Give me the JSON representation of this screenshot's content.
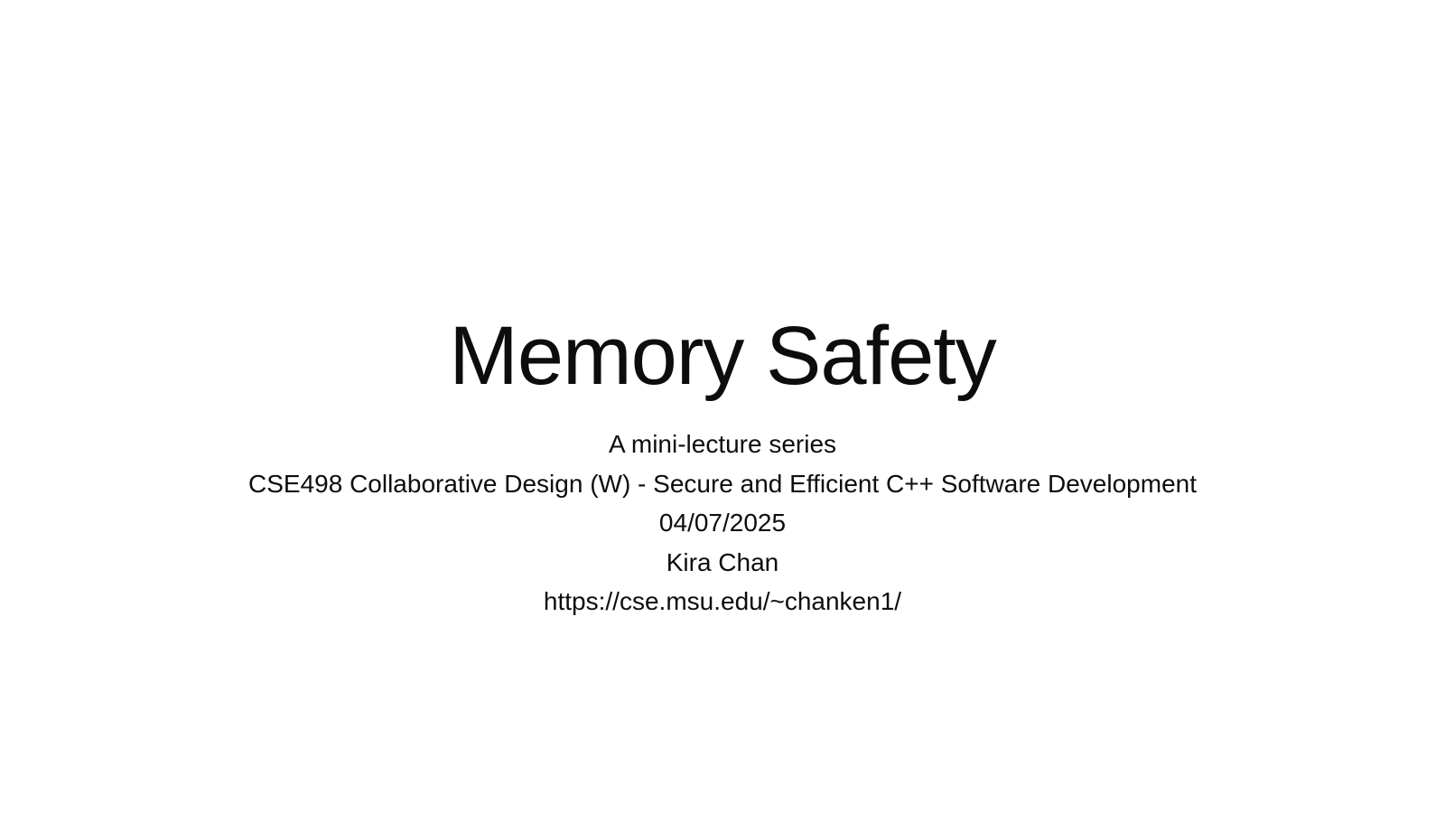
{
  "slide": {
    "title": "Memory Safety",
    "subtitle_lines": [
      "A mini-lecture series",
      "CSE498 Collaborative Design (W) - Secure and Efficient C++ Software Development",
      "04/07/2025",
      "Kira Chan",
      "https://cse.msu.edu/~chanken1/"
    ]
  }
}
